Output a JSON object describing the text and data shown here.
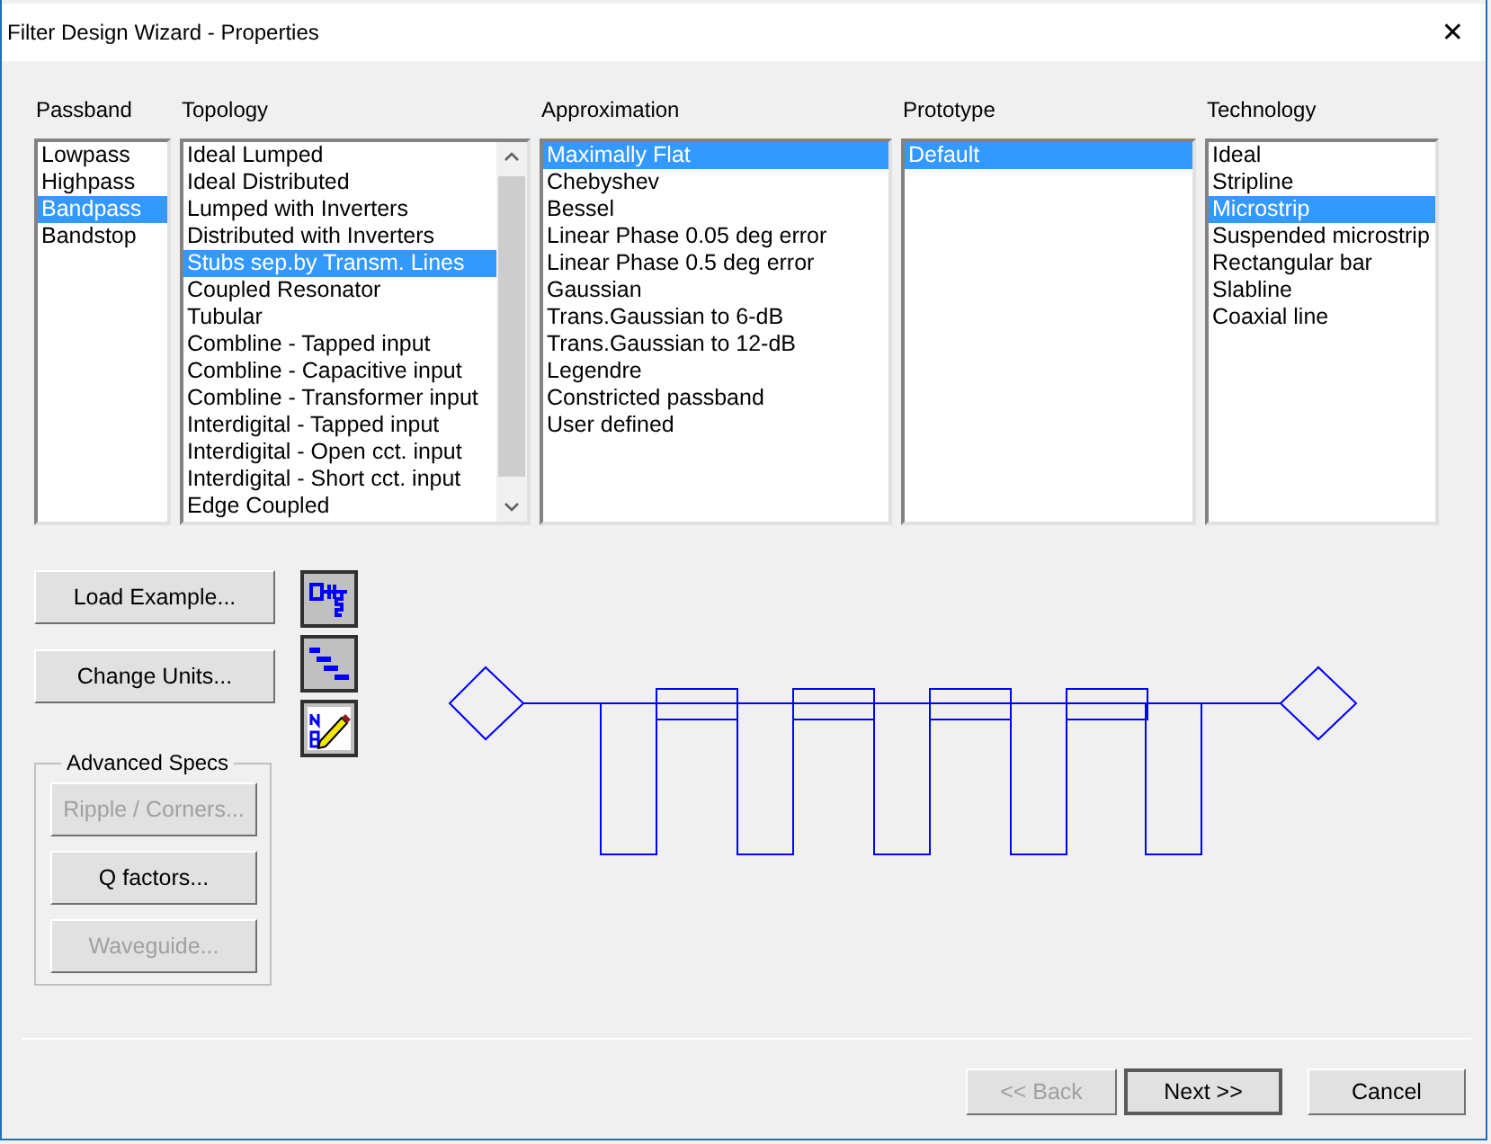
{
  "window": {
    "title": "Filter Design Wizard - Properties",
    "close": "✕"
  },
  "columns": [
    {
      "label": "Passband",
      "scrollbar": false,
      "items": [
        {
          "label": "Lowpass",
          "selected": false
        },
        {
          "label": "Highpass",
          "selected": false
        },
        {
          "label": "Bandpass",
          "selected": true
        },
        {
          "label": "Bandstop",
          "selected": false
        }
      ]
    },
    {
      "label": "Topology",
      "scrollbar": true,
      "items": [
        {
          "label": "Ideal Lumped",
          "selected": false
        },
        {
          "label": "Ideal Distributed",
          "selected": false
        },
        {
          "label": "Lumped with Inverters",
          "selected": false
        },
        {
          "label": "Distributed with Inverters",
          "selected": false
        },
        {
          "label": "Stubs sep.by Transm. Lines",
          "selected": true
        },
        {
          "label": "Coupled Resonator",
          "selected": false
        },
        {
          "label": "Tubular",
          "selected": false
        },
        {
          "label": "Combline - Tapped input",
          "selected": false
        },
        {
          "label": "Combline - Capacitive input",
          "selected": false
        },
        {
          "label": "Combline - Transformer input",
          "selected": false
        },
        {
          "label": "Interdigital - Tapped input",
          "selected": false
        },
        {
          "label": "Interdigital - Open cct. input",
          "selected": false
        },
        {
          "label": "Interdigital - Short cct. input",
          "selected": false
        },
        {
          "label": "Edge Coupled",
          "selected": false
        }
      ]
    },
    {
      "label": "Approximation",
      "scrollbar": false,
      "items": [
        {
          "label": "Maximally Flat",
          "selected": true
        },
        {
          "label": "Chebyshev",
          "selected": false
        },
        {
          "label": "Bessel",
          "selected": false
        },
        {
          "label": "Linear Phase 0.05 deg error",
          "selected": false
        },
        {
          "label": "Linear Phase 0.5 deg error",
          "selected": false
        },
        {
          "label": "Gaussian",
          "selected": false
        },
        {
          "label": "Trans.Gaussian to 6-dB",
          "selected": false
        },
        {
          "label": "Trans.Gaussian to 12-dB",
          "selected": false
        },
        {
          "label": "Legendre",
          "selected": false
        },
        {
          "label": "Constricted passband",
          "selected": false
        },
        {
          "label": "User defined",
          "selected": false
        }
      ]
    },
    {
      "label": "Prototype",
      "scrollbar": false,
      "items": [
        {
          "label": "Default",
          "selected": true
        }
      ]
    },
    {
      "label": "Technology",
      "scrollbar": false,
      "items": [
        {
          "label": "Ideal",
          "selected": false
        },
        {
          "label": "Stripline",
          "selected": false
        },
        {
          "label": "Microstrip",
          "selected": true
        },
        {
          "label": "Suspended microstrip",
          "selected": false
        },
        {
          "label": "Rectangular bar",
          "selected": false
        },
        {
          "label": "Slabline",
          "selected": false
        },
        {
          "label": "Coaxial line",
          "selected": false
        }
      ]
    }
  ],
  "side_buttons": [
    {
      "label": "Load Example...",
      "disabled": false
    },
    {
      "label": "Change Units...",
      "disabled": false
    }
  ],
  "tool_buttons": [
    {
      "kind": "schematic"
    },
    {
      "kind": "layout"
    },
    {
      "kind": "edit"
    }
  ],
  "advanced_specs": {
    "title": "Advanced Specs",
    "buttons": [
      {
        "label": "Ripple / Corners...",
        "disabled": true
      },
      {
        "label": "Q factors...",
        "disabled": false
      },
      {
        "label": "Waveguide...",
        "disabled": true
      }
    ]
  },
  "nav_buttons": [
    {
      "label": "<< Back",
      "disabled": true,
      "default": false
    },
    {
      "label": "Next >>",
      "disabled": false,
      "default": true
    },
    {
      "label": "Cancel",
      "disabled": false,
      "default": false
    }
  ]
}
